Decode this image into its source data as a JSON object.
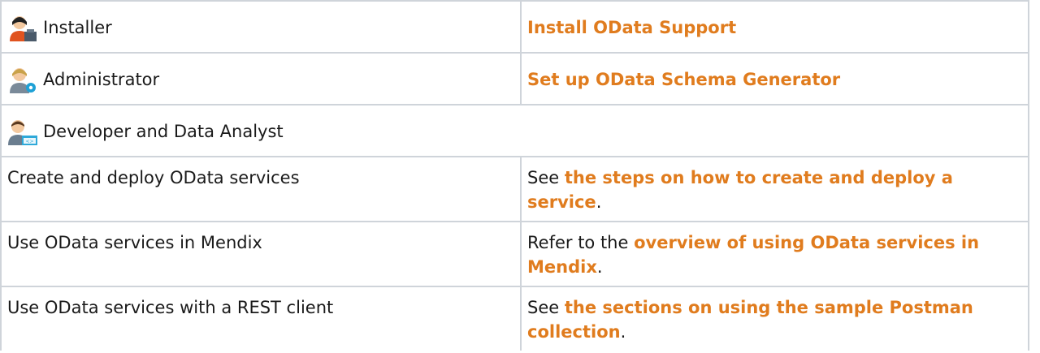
{
  "colors": {
    "link": "#e07c1e",
    "border": "#cfd4da",
    "text": "#1a1a1a"
  },
  "roles": [
    {
      "icon": "installer-icon",
      "label": "Installer",
      "link": "Install OData Support"
    },
    {
      "icon": "administrator-icon",
      "label": "Administrator",
      "link": "Set up OData Schema Generator"
    },
    {
      "icon": "developer-icon",
      "label": "Developer and Data Analyst"
    }
  ],
  "tasks": [
    {
      "task": "Create and deploy OData services",
      "prefix": "See ",
      "link": "the steps on how to create and deploy a service",
      "suffix": "."
    },
    {
      "task": "Use OData services in Mendix",
      "prefix": "Refer to the ",
      "link": "overview of using OData services in Mendix",
      "suffix": "."
    },
    {
      "task": "Use OData services with a REST client",
      "prefix": "See ",
      "link": "the sections on using the sample Postman collection",
      "suffix": "."
    }
  ]
}
